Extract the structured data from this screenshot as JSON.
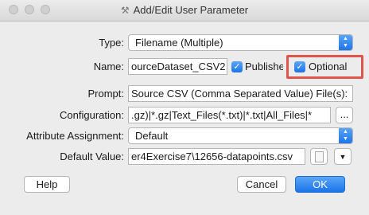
{
  "window": {
    "title": "Add/Edit User Parameter"
  },
  "form": {
    "type_label": "Type:",
    "type_value": "Filename (Multiple)",
    "name_label": "Name:",
    "name_value": "ourceDataset_CSV2",
    "published_label": "Published",
    "optional_label": "Optional",
    "prompt_label": "Prompt:",
    "prompt_value": "Source CSV (Comma Separated Value) File(s):",
    "configuration_label": "Configuration:",
    "configuration_value": ".gz)|*.gz|Text_Files(*.txt)|*.txt|All_Files|*",
    "configuration_browse": "...",
    "attribute_label": "Attribute Assignment:",
    "attribute_value": "Default",
    "default_label": "Default Value:",
    "default_value": "er4Exercise7\\12656-datapoints.csv"
  },
  "buttons": {
    "help": "Help",
    "cancel": "Cancel",
    "ok": "OK"
  },
  "checkboxes": {
    "published": true,
    "optional": true
  },
  "colors": {
    "accent": "#1b73e8",
    "highlight": "#e0554b"
  }
}
